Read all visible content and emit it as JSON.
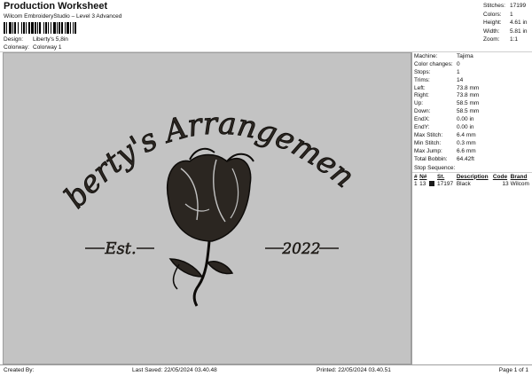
{
  "header": {
    "title": "Production Worksheet",
    "subtitle": "Wilcom EmbroideryStudio – Level 3 Advanced",
    "design_label": "Design:",
    "design_value": "Liberty's 5,8in",
    "colorway_label": "Colorway:",
    "colorway_value": "Colorway 1"
  },
  "summary": [
    {
      "label": "Stitches:",
      "value": "17199"
    },
    {
      "label": "Colors:",
      "value": "1"
    },
    {
      "label": "Height:",
      "value": "4.61 in"
    },
    {
      "label": "Width:",
      "value": "5.81 in"
    },
    {
      "label": "Zoom:",
      "value": "1:1"
    }
  ],
  "properties": [
    {
      "label": "Machine:",
      "value": "Tajima"
    },
    {
      "label": "Color changes:",
      "value": "0"
    },
    {
      "label": "Stops:",
      "value": "1"
    },
    {
      "label": "Trims:",
      "value": "14"
    },
    {
      "label": "Left:",
      "value": "73.8 mm"
    },
    {
      "label": "Right:",
      "value": "73.8 mm"
    },
    {
      "label": "Up:",
      "value": "58.5 mm"
    },
    {
      "label": "Down:",
      "value": "58.5 mm"
    },
    {
      "label": "EndX:",
      "value": "0.00 in"
    },
    {
      "label": "EndY:",
      "value": "0.00 in"
    },
    {
      "label": "Max Stitch:",
      "value": "6.4 mm"
    },
    {
      "label": "Min Stitch:",
      "value": "0.3 mm"
    },
    {
      "label": "Max Jump:",
      "value": "6.6 mm"
    },
    {
      "label": "Total Bobbin:",
      "value": "64.42ft"
    }
  ],
  "stop_sequence": {
    "title": "Stop Sequence:",
    "columns": [
      "#",
      "N#",
      "",
      "St.",
      "Description",
      "Code",
      "Brand"
    ],
    "rows": [
      {
        "num": "1",
        "n": "13",
        "color": "#1a1a1a",
        "stitches": "17197",
        "description": "Black",
        "code": "13",
        "brand": "Wilcom"
      }
    ]
  },
  "design_art": {
    "arc_text": "Liberty's Arrangements",
    "left_text": "Est.",
    "right_text": "2022",
    "thread_color": "#2b2621",
    "background_color": "#c3c3c3"
  },
  "footer": {
    "created_by": "Created By:",
    "last_saved": "Last Saved: 22/05/2024 03.40.48",
    "printed": "Printed: 22/05/2024 03.40.51",
    "page": "Page 1 of 1"
  }
}
